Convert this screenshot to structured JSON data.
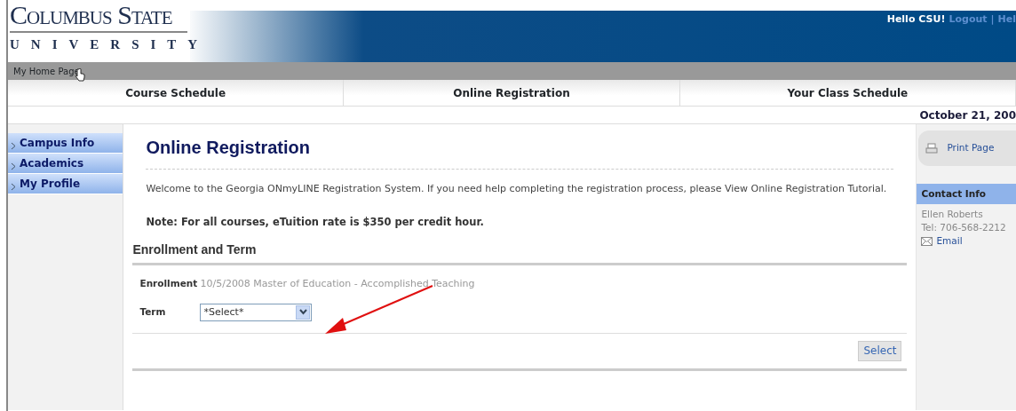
{
  "header": {
    "logo_line1": "Columbus State",
    "logo_line2": "UNIVERSITY",
    "greeting": "Hello CSU!",
    "links": [
      "Logout",
      "Hel"
    ],
    "separator": "|"
  },
  "breadcrumb": {
    "link": "My Home Page"
  },
  "nav": [
    {
      "label": "Course Schedule",
      "selected": false
    },
    {
      "label": "Online Registration",
      "selected": false
    },
    {
      "label": "Your Class Schedule",
      "selected": false
    }
  ],
  "date": "October 21, 200",
  "sidebar": {
    "items": [
      {
        "label": "Campus Info"
      },
      {
        "label": "Academics"
      },
      {
        "label": "My Profile"
      }
    ]
  },
  "main": {
    "title": "Online Registration",
    "welcome": "Welcome to the Georgia ONmyLINE Registration System. If you need help completing the registration process, please View Online Registration Tutorial.",
    "note": "Note: For all courses, eTuition rate is $350 per credit hour.",
    "section_title": "Enrollment and Term",
    "fields": [
      {
        "kind": "text",
        "label": "Enrollment",
        "value": "10/5/2008 Master of Education - Accomplished Teaching"
      },
      {
        "kind": "select",
        "label": "Term",
        "value": "*Select*"
      }
    ],
    "button": "Select"
  },
  "right_panel": {
    "print": "Print Page",
    "contact_title": "Contact Info",
    "contact_name": "Ellen Roberts",
    "contact_tel": "Tel: 706-568-2212",
    "email": "Email"
  }
}
